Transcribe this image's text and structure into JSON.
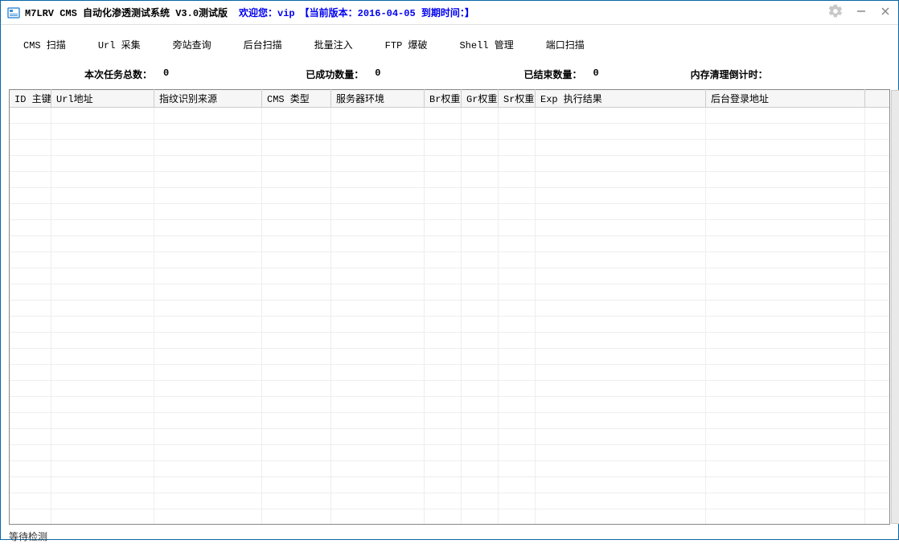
{
  "titlebar": {
    "app_name": "M7LRV CMS 自动化渗透测试系统 V3.0测试版",
    "welcome": "欢迎您：vip",
    "version_info": "【当前版本：2016-04-05  到期时间：】"
  },
  "tabs": [
    "CMS 扫描",
    "Url 采集",
    "旁站查询",
    "后台扫描",
    "批量注入",
    "FTP 爆破",
    "Shell 管理",
    "端口扫描"
  ],
  "stats": {
    "total_label": "本次任务总数：",
    "total_value": "0",
    "success_label": "已成功数量：",
    "success_value": "0",
    "finished_label": "已结束数量：",
    "finished_value": "0",
    "countdown_label": "内存清理倒计时："
  },
  "columns": {
    "id": "ID 主键",
    "url": "Url地址",
    "fingerprint": "指纹识别来源",
    "cms": "CMS 类型",
    "server": "服务器环境",
    "br": "Br权重",
    "gr": "Gr权重",
    "sr": "Sr权重",
    "exp": "Exp 执行结果",
    "backend": "后台登录地址"
  },
  "status": "等待检测"
}
